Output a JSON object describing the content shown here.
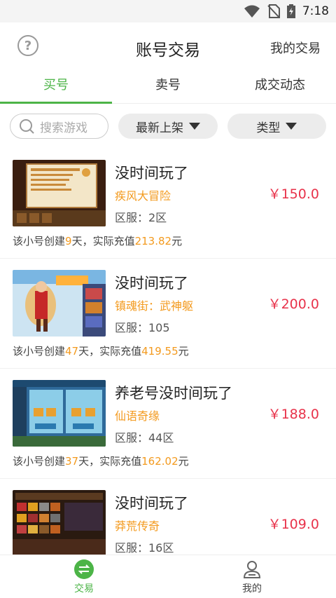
{
  "status_bar": {
    "time": "7:18"
  },
  "header": {
    "help_icon": "?",
    "title": "账号交易",
    "my_trade": "我的交易"
  },
  "tabs": [
    {
      "label": "买号"
    },
    {
      "label": "卖号"
    },
    {
      "label": "成交动态"
    }
  ],
  "filters": {
    "search_placeholder": "搜索游戏",
    "sort_label": "最新上架",
    "type_label": "类型"
  },
  "listings": [
    {
      "title": "没时间玩了",
      "game": "疾风大冒险",
      "server_label": "区服：2区",
      "price": "￥150.0",
      "meta_prefix": "该小号创建",
      "days": "9",
      "meta_mid": "天，实际充值",
      "recharge": "213.82",
      "meta_suffix": "元"
    },
    {
      "title": "没时间玩了",
      "game": "镇魂街：武神躯",
      "server_label": "区服：105",
      "price": "￥200.0",
      "meta_prefix": "该小号创建",
      "days": "47",
      "meta_mid": "天，实际充值",
      "recharge": "419.55",
      "meta_suffix": "元"
    },
    {
      "title": "养老号没时间玩了",
      "game": "仙语奇缘",
      "server_label": "区服：44区",
      "price": "￥188.0",
      "meta_prefix": "该小号创建",
      "days": "37",
      "meta_mid": "天，实际充值",
      "recharge": "162.02",
      "meta_suffix": "元"
    },
    {
      "title": "没时间玩了",
      "game": "莽荒传奇",
      "server_label": "区服：16区",
      "price": "￥109.0",
      "meta_prefix": "",
      "days": "",
      "meta_mid": "",
      "recharge": "",
      "meta_suffix": ""
    }
  ],
  "bottom_nav": {
    "trade_label": "交易",
    "me_label": "我的"
  },
  "colors": {
    "accent_green": "#4cb447",
    "price_red": "#e8324a",
    "highlight_orange": "#f39a1e"
  }
}
